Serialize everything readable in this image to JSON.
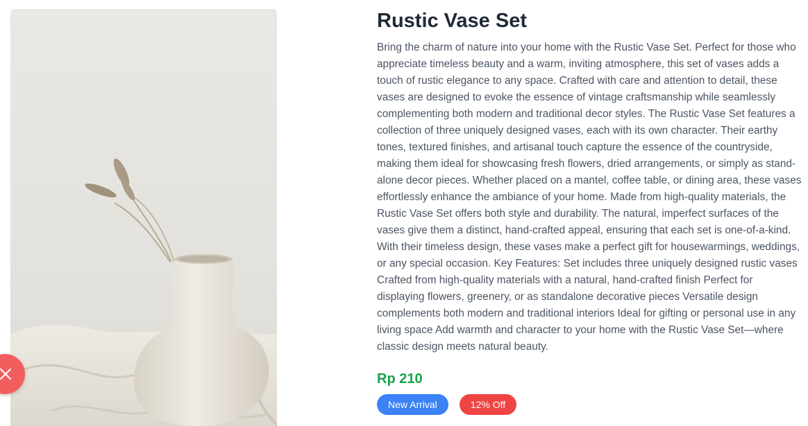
{
  "product": {
    "title": "Rustic Vase Set",
    "description": "Bring the charm of nature into your home with the Rustic Vase Set. Perfect for those who appreciate timeless beauty and a warm, inviting atmosphere, this set of vases adds a touch of rustic elegance to any space. Crafted with care and attention to detail, these vases are designed to evoke the essence of vintage craftsmanship while seamlessly complementing both modern and traditional decor styles. The Rustic Vase Set features a collection of three uniquely designed vases, each with its own character. Their earthy tones, textured finishes, and artisanal touch capture the essence of the countryside, making them ideal for showcasing fresh flowers, dried arrangements, or simply as stand-alone decor pieces. Whether placed on a mantel, coffee table, or dining area, these vases effortlessly enhance the ambiance of your home. Made from high-quality materials, the Rustic Vase Set offers both style and durability. The natural, imperfect surfaces of the vases give them a distinct, hand-crafted appeal, ensuring that each set is one-of-a-kind. With their timeless design, these vases make a perfect gift for housewarmings, weddings, or any special occasion. Key Features: Set includes three uniquely designed rustic vases Crafted from high-quality materials with a natural, hand-crafted finish Perfect for displaying flowers, greenery, or as standalone decorative pieces Versatile design complements both modern and traditional interiors Ideal for gifting or personal use in any living space Add warmth and character to your home with the Rustic Vase Set—where classic design meets natural beauty.",
    "price": "Rp 210",
    "badges": {
      "new_arrival": "New Arrival",
      "discount": "12% Off"
    }
  },
  "image": {
    "subject": "white ceramic vase with dried grass on linen cloth"
  },
  "icons": {
    "close": "close-icon"
  },
  "colors": {
    "price": "#16a34a",
    "badge_new": "#3b82f6",
    "badge_discount": "#ef4444",
    "close_button": "#f25e5e",
    "title": "#1f2937",
    "text": "#4b5563"
  }
}
